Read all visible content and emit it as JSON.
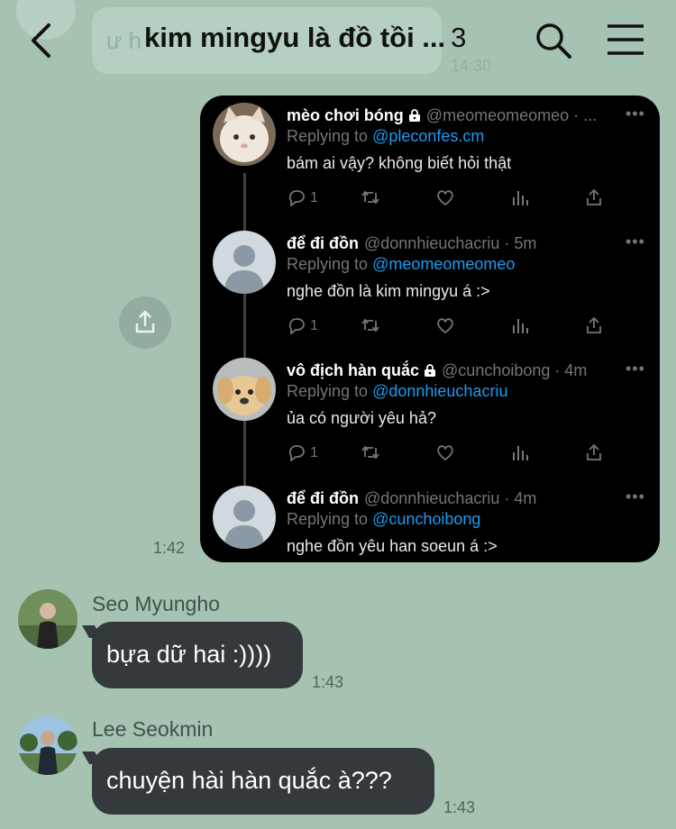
{
  "header": {
    "title": "kim mingyu là đồ tồi ...",
    "count": "3",
    "prev_message": "ư h",
    "prev_time": "14:30"
  },
  "tweets": [
    {
      "name": "mèo chơi bóng",
      "locked": true,
      "handle": "@meomeomeomeo · ...",
      "reply_label": "Replying to",
      "reply_to": "@pleconfes.cm",
      "text": "bám ai vậy? không biết hỏi thật",
      "reply_count": "1",
      "avatar": "cat-avatar"
    },
    {
      "name": "để đi đồn",
      "locked": false,
      "handle": "@donnhieuchacriu · 5m",
      "reply_label": "Replying to",
      "reply_to": "@meomeomeomeo",
      "text": "nghe đồn là kim mingyu á :>",
      "reply_count": "1",
      "avatar": "default-avatar"
    },
    {
      "name": "vô địch hàn quắc",
      "locked": true,
      "handle": "@cunchoibong · 4m",
      "reply_label": "Replying to",
      "reply_to": "@donnhieuchacriu",
      "text": "ủa có người yêu hả?",
      "reply_count": "1",
      "avatar": "dog-avatar"
    },
    {
      "name": "để đi đồn",
      "locked": false,
      "handle": "@donnhieuchacriu · 4m",
      "reply_label": "Replying to",
      "reply_to": "@cunchoibong",
      "text": "nghe đồn yêu han soeun á :>",
      "reply_count": "",
      "avatar": "default-avatar"
    }
  ],
  "image_message_time": "1:42",
  "messages": [
    {
      "sender": "Seo Myungho",
      "text": "bựa dữ hai :))))",
      "time": "1:43"
    },
    {
      "sender": "Lee Seokmin",
      "text": "chuyện hài hàn quắc à???",
      "time": "1:43"
    }
  ],
  "colors": {
    "chat_background": "#a6c2b1",
    "bubble": "#34393d",
    "tweet_link": "#1d9bf0",
    "tweet_muted": "#71767b"
  }
}
